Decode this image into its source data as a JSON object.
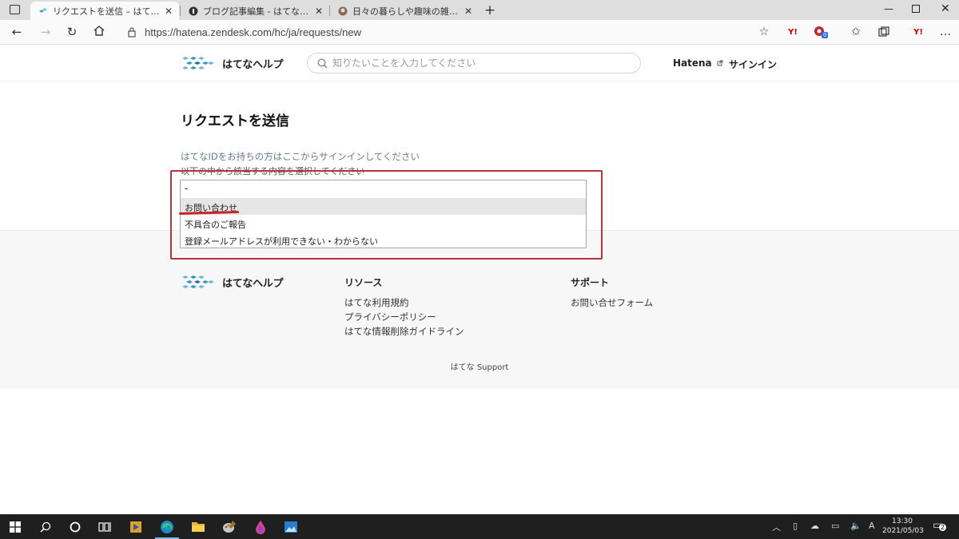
{
  "browser": {
    "tabs": [
      {
        "title": "リクエストを送信 – はてな Support",
        "active": true
      },
      {
        "title": "ブログ記事編集 - はてなブログ",
        "active": false
      },
      {
        "title": "日々の暮らしや趣味の雑記 - 日々の",
        "active": false
      }
    ],
    "url": "https://hatena.zendesk.com/hc/ja/requests/new",
    "extension_badge": "0"
  },
  "header": {
    "brand": "はてなヘルプ",
    "search_placeholder": "知りたいことを入力してください",
    "hatena_link": "Hatena",
    "signin": "サインイン"
  },
  "main": {
    "title": "リクエストを送信",
    "signin_prompt": "はてなIDをお持ちの方はここからサインインしてください",
    "instruction": "以下の中から該当する内容を選択してください",
    "select": {
      "current": "-",
      "options": [
        {
          "label": "お問い合わせ",
          "highlighted": true
        },
        {
          "label": "不具合のご報告",
          "highlighted": false
        },
        {
          "label": "登録メールアドレスが利用できない・わからない",
          "highlighted": false
        }
      ]
    }
  },
  "footer": {
    "brand": "はてなヘルプ",
    "resources": {
      "heading": "リソース",
      "links": [
        "はてな利用規約",
        "プライバシーポリシー",
        "はてな情報削除ガイドライン"
      ]
    },
    "support": {
      "heading": "サポート",
      "links": [
        "お問い合せフォーム"
      ]
    },
    "copyright": "はてな Support"
  },
  "taskbar": {
    "time": "13:30",
    "date": "2021/05/03",
    "notifications": "2"
  },
  "colors": {
    "annotation_red": "#b5333a",
    "link_blue": "#6a7a90",
    "taskbar_bg": "#1f1f1f"
  }
}
